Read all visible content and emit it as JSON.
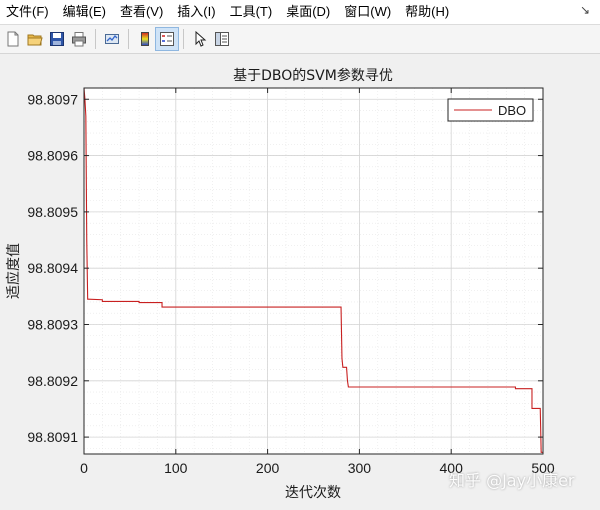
{
  "menubar": {
    "items": [
      "文件(F)",
      "编辑(E)",
      "查看(V)",
      "插入(I)",
      "工具(T)",
      "桌面(D)",
      "窗口(W)",
      "帮助(H)"
    ],
    "overflow_glyph": "↘"
  },
  "toolbar": {
    "icons": [
      "new-file-icon",
      "open-folder-icon",
      "save-icon",
      "print-icon",
      "link-plot-icon",
      "colorbar-icon",
      "legend-icon",
      "pointer-icon",
      "property-editor-icon"
    ]
  },
  "watermark": "知乎 @Jay小康er",
  "chart_data": {
    "type": "line",
    "title": "基于DBO的SVM参数寻优",
    "xlabel": "迭代次数",
    "ylabel": "适应度值",
    "xlim": [
      0,
      500
    ],
    "ylim": [
      98.80907,
      98.80972
    ],
    "xticks": [
      0,
      100,
      200,
      300,
      400,
      500
    ],
    "yticks": [
      98.8091,
      98.8092,
      98.8093,
      98.8094,
      98.8095,
      98.8096,
      98.8097
    ],
    "xtick_labels": [
      "0",
      "100",
      "200",
      "300",
      "400",
      "500"
    ],
    "ytick_labels": [
      "98.8091",
      "98.8092",
      "98.8093",
      "98.8094",
      "98.8095",
      "98.8096",
      "98.8097"
    ],
    "grid": true,
    "minor_grid": true,
    "legend_position": "top-right",
    "series": [
      {
        "name": "DBO",
        "color": "#c82020",
        "x": [
          0,
          1,
          2,
          3,
          4,
          5,
          20,
          20,
          60,
          60,
          85,
          85,
          280,
          281,
          282,
          286,
          287,
          288,
          470,
          470,
          488,
          488,
          497,
          498,
          500
        ],
        "y": [
          98.80972,
          98.8097,
          98.80967,
          98.80945,
          98.809345,
          98.809345,
          98.809344,
          98.809341,
          98.809341,
          98.809339,
          98.809339,
          98.809331,
          98.809331,
          98.80924,
          98.809224,
          98.809224,
          98.8092,
          98.809189,
          98.809189,
          98.809186,
          98.809186,
          98.809151,
          98.809151,
          98.809073,
          98.809073
        ]
      }
    ]
  }
}
